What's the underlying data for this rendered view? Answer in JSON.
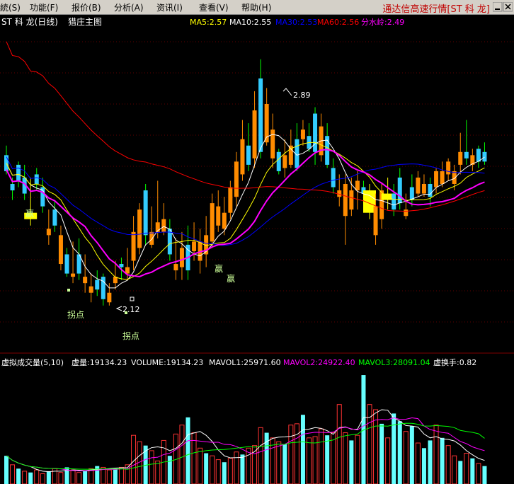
{
  "menu": {
    "items": [
      "統(S)",
      "功能(F)",
      "报价(B)",
      "分析(A)",
      "资讯(I)",
      "查看(V)",
      "帮助(H)"
    ],
    "app_title": "通达信高速行情[ST 科 龙]"
  },
  "colors": {
    "background": "#000000",
    "up": "#ff8c00",
    "down": "#33ccff",
    "yellow_bar": "#ffff00",
    "ma5": "#ffffff",
    "ma10": "#ffff00",
    "ma30": "#0000ff",
    "ma60": "#ff0000",
    "ma_fen": "#ff00ff",
    "green_line": "#00ff00",
    "vol_mavol1": "#ffffff",
    "vol_mavol2": "#ff00ff",
    "vol_mavol3": "#00ff00"
  },
  "chart_data": [
    {
      "type": "candlestick",
      "title": "ST 科 龙(日线)",
      "subtitle": "猎庄主图",
      "indicators": [
        {
          "label": "MA5:2.57",
          "color": "#ffff00"
        },
        {
          "label": "MA10:2.55",
          "color": "#ffffff"
        },
        {
          "label": "MA30:2.53",
          "color": "#0000ff"
        },
        {
          "label": "MA60:2.56",
          "color": "#ff0000"
        },
        {
          "label": "分水岭:2.49",
          "color": "#ff00ff"
        }
      ],
      "ylim": [
        2.02,
        2.98
      ],
      "candles": [
        [
          2.59,
          2.62,
          2.54,
          2.53,
          "d"
        ],
        [
          2.5,
          2.52,
          2.48,
          2.45,
          "d"
        ],
        [
          2.56,
          2.57,
          2.51,
          2.49,
          "d"
        ],
        [
          2.52,
          2.56,
          2.47,
          2.45,
          "d"
        ],
        [
          2.41,
          2.52,
          2.39,
          2.37,
          "y"
        ],
        [
          2.53,
          2.55,
          2.5,
          2.48,
          "d"
        ],
        [
          2.49,
          2.52,
          2.43,
          2.41,
          "d"
        ],
        [
          2.36,
          2.42,
          2.34,
          2.31,
          "u"
        ],
        [
          2.42,
          2.45,
          2.37,
          2.35,
          "d"
        ],
        [
          2.34,
          2.37,
          2.25,
          2.23,
          "u"
        ],
        [
          2.28,
          2.3,
          2.22,
          2.21,
          "d"
        ],
        [
          2.22,
          2.32,
          2.21,
          2.19,
          "u"
        ],
        [
          2.28,
          2.33,
          2.22,
          2.2,
          "d"
        ],
        [
          2.21,
          2.28,
          2.19,
          2.16,
          "u"
        ],
        [
          2.18,
          2.22,
          2.16,
          2.13,
          "u"
        ],
        [
          2.2,
          2.23,
          2.17,
          2.15,
          "d"
        ],
        [
          2.21,
          2.22,
          2.14,
          2.12,
          "d"
        ],
        [
          2.16,
          2.19,
          2.13,
          2.12,
          "u"
        ],
        [
          2.21,
          2.26,
          2.19,
          2.17,
          "u"
        ],
        [
          2.25,
          2.27,
          2.24,
          2.2,
          "d"
        ],
        [
          2.24,
          2.3,
          2.22,
          2.2,
          "u"
        ],
        [
          2.35,
          2.4,
          2.26,
          2.23,
          "u"
        ],
        [
          2.42,
          2.44,
          2.3,
          2.28,
          "u"
        ],
        [
          2.48,
          2.5,
          2.34,
          2.31,
          "d"
        ],
        [
          2.35,
          2.43,
          2.31,
          2.3,
          "u"
        ],
        [
          2.38,
          2.51,
          2.35,
          2.33,
          "u"
        ],
        [
          2.39,
          2.44,
          2.35,
          2.34,
          "u"
        ],
        [
          2.36,
          2.39,
          2.28,
          2.26,
          "d"
        ],
        [
          2.25,
          2.33,
          2.23,
          2.2,
          "u"
        ],
        [
          2.3,
          2.35,
          2.24,
          2.2,
          "u"
        ],
        [
          2.31,
          2.37,
          2.23,
          2.2,
          "d"
        ],
        [
          2.32,
          2.38,
          2.29,
          2.26,
          "u"
        ],
        [
          2.32,
          2.36,
          2.26,
          2.22,
          "u"
        ],
        [
          2.34,
          2.4,
          2.28,
          2.24,
          "u"
        ],
        [
          2.44,
          2.47,
          2.32,
          2.3,
          "u"
        ],
        [
          2.43,
          2.48,
          2.37,
          2.35,
          "u"
        ],
        [
          2.41,
          2.46,
          2.36,
          2.34,
          "u"
        ],
        [
          2.49,
          2.51,
          2.41,
          2.39,
          "u"
        ],
        [
          2.57,
          2.6,
          2.46,
          2.43,
          "u"
        ],
        [
          2.64,
          2.7,
          2.53,
          2.51,
          "u"
        ],
        [
          2.62,
          2.69,
          2.56,
          2.54,
          "d"
        ],
        [
          2.73,
          2.79,
          2.58,
          2.55,
          "u"
        ],
        [
          2.83,
          2.89,
          2.6,
          2.58,
          "d"
        ],
        [
          2.75,
          2.8,
          2.63,
          2.62,
          "u"
        ],
        [
          2.67,
          2.72,
          2.58,
          2.55,
          "u"
        ],
        [
          2.6,
          2.61,
          2.54,
          2.53,
          "d"
        ],
        [
          2.59,
          2.64,
          2.55,
          2.52,
          "u"
        ],
        [
          2.62,
          2.67,
          2.56,
          2.55,
          "u"
        ],
        [
          2.64,
          2.69,
          2.55,
          2.54,
          "d"
        ],
        [
          2.67,
          2.7,
          2.64,
          2.62,
          "u"
        ],
        [
          2.65,
          2.69,
          2.61,
          2.6,
          "d"
        ],
        [
          2.72,
          2.74,
          2.6,
          2.56,
          "d"
        ],
        [
          2.68,
          2.72,
          2.59,
          2.57,
          "u"
        ],
        [
          2.65,
          2.69,
          2.56,
          2.55,
          "d"
        ],
        [
          2.55,
          2.58,
          2.49,
          2.47,
          "d"
        ],
        [
          2.48,
          2.53,
          2.46,
          2.43,
          "u"
        ],
        [
          2.5,
          2.53,
          2.4,
          2.31,
          "u"
        ],
        [
          2.48,
          2.52,
          2.42,
          2.4,
          "u"
        ],
        [
          2.51,
          2.54,
          2.48,
          2.42,
          "u"
        ],
        [
          2.49,
          2.51,
          2.47,
          2.45,
          "d"
        ],
        [
          2.48,
          2.5,
          2.41,
          2.39,
          "y"
        ],
        [
          2.43,
          2.47,
          2.34,
          2.31,
          "u"
        ],
        [
          2.48,
          2.5,
          2.39,
          2.36,
          "u"
        ],
        [
          2.47,
          2.52,
          2.45,
          2.42,
          "y"
        ],
        [
          2.47,
          2.5,
          2.42,
          2.4,
          "d"
        ],
        [
          2.52,
          2.55,
          2.44,
          2.42,
          "d"
        ],
        [
          2.42,
          2.47,
          2.4,
          2.39,
          "u"
        ],
        [
          2.49,
          2.53,
          2.45,
          2.43,
          "d"
        ],
        [
          2.52,
          2.54,
          2.47,
          2.46,
          "u"
        ],
        [
          2.5,
          2.53,
          2.47,
          2.46,
          "u"
        ],
        [
          2.5,
          2.52,
          2.46,
          2.43,
          "d"
        ],
        [
          2.54,
          2.55,
          2.49,
          2.47,
          "u"
        ],
        [
          2.54,
          2.57,
          2.5,
          2.49,
          "u"
        ],
        [
          2.57,
          2.58,
          2.53,
          2.51,
          "u"
        ],
        [
          2.54,
          2.56,
          2.5,
          2.48,
          "u"
        ],
        [
          2.6,
          2.66,
          2.56,
          2.53,
          "u"
        ],
        [
          2.6,
          2.7,
          2.58,
          2.56,
          "d"
        ],
        [
          2.59,
          2.61,
          2.56,
          2.54,
          "u"
        ],
        [
          2.61,
          2.62,
          2.57,
          2.55,
          "d"
        ],
        [
          2.6,
          2.63,
          2.57,
          2.56,
          "d"
        ]
      ],
      "annotations": {
        "high_label": "2.89",
        "low_label": "2.12",
        "zhuan_dian_1": "拐点",
        "zhuan_dian_2": "拐点",
        "ying_1": "赢",
        "ying_2": "赢"
      }
    },
    {
      "type": "bar",
      "title": "虚拟成交量(5,10)",
      "indicators": [
        {
          "label": "虚量:19134.23",
          "color": "#ffffff"
        },
        {
          "label": "VOLUME:19134.23",
          "color": "#ffffff"
        },
        {
          "label": "MAVOL1:25971.60",
          "color": "#ffffff"
        },
        {
          "label": "MAVOL2:24922.40",
          "color": "#ff00ff"
        },
        {
          "label": "MAVOL3:28091.04",
          "color": "#00ff00"
        },
        {
          "label": "虚换手:0.82",
          "color": "#ffffff"
        }
      ],
      "volumes": [
        [
          22,
          "d"
        ],
        [
          15,
          "u"
        ],
        [
          12,
          "d"
        ],
        [
          10,
          "u"
        ],
        [
          9,
          "d"
        ],
        [
          11,
          "u"
        ],
        [
          8,
          "u"
        ],
        [
          10,
          "d"
        ],
        [
          12,
          "u"
        ],
        [
          9,
          "u"
        ],
        [
          13,
          "d"
        ],
        [
          11,
          "u"
        ],
        [
          9,
          "u"
        ],
        [
          10,
          "d"
        ],
        [
          12,
          "u"
        ],
        [
          14,
          "d"
        ],
        [
          13,
          "u"
        ],
        [
          11,
          "u"
        ],
        [
          12,
          "d"
        ],
        [
          13,
          "u"
        ],
        [
          15,
          "u"
        ],
        [
          38,
          "u"
        ],
        [
          33,
          "u"
        ],
        [
          30,
          "d"
        ],
        [
          26,
          "u"
        ],
        [
          18,
          "u"
        ],
        [
          34,
          "u"
        ],
        [
          22,
          "d"
        ],
        [
          39,
          "u"
        ],
        [
          46,
          "u"
        ],
        [
          52,
          "d"
        ],
        [
          40,
          "u"
        ],
        [
          28,
          "u"
        ],
        [
          24,
          "d"
        ],
        [
          22,
          "u"
        ],
        [
          19,
          "u"
        ],
        [
          17,
          "d"
        ],
        [
          20,
          "u"
        ],
        [
          25,
          "u"
        ],
        [
          23,
          "d"
        ],
        [
          28,
          "u"
        ],
        [
          30,
          "u"
        ],
        [
          44,
          "u"
        ],
        [
          40,
          "d"
        ],
        [
          36,
          "u"
        ],
        [
          33,
          "u"
        ],
        [
          31,
          "d"
        ],
        [
          46,
          "u"
        ],
        [
          47,
          "u"
        ],
        [
          54,
          "d"
        ],
        [
          36,
          "u"
        ],
        [
          37,
          "u"
        ],
        [
          43,
          "u"
        ],
        [
          38,
          "d"
        ],
        [
          40,
          "u"
        ],
        [
          62,
          "u"
        ],
        [
          40,
          "u"
        ],
        [
          34,
          "d"
        ],
        [
          38,
          "u"
        ],
        [
          85,
          "d"
        ],
        [
          62,
          "u"
        ],
        [
          58,
          "u"
        ],
        [
          47,
          "d"
        ],
        [
          36,
          "u"
        ],
        [
          55,
          "d"
        ],
        [
          49,
          "d"
        ],
        [
          41,
          "u"
        ],
        [
          45,
          "d"
        ],
        [
          32,
          "u"
        ],
        [
          28,
          "d"
        ],
        [
          34,
          "d"
        ],
        [
          46,
          "u"
        ],
        [
          36,
          "d"
        ],
        [
          30,
          "u"
        ],
        [
          22,
          "u"
        ],
        [
          18,
          "d"
        ],
        [
          24,
          "u"
        ],
        [
          20,
          "d"
        ],
        [
          16,
          "u"
        ],
        [
          14,
          "d"
        ]
      ]
    }
  ]
}
